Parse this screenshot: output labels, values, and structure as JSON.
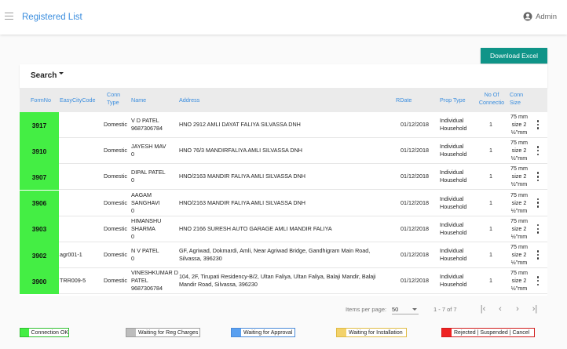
{
  "header": {
    "title": "Registered List",
    "user_name": "Admin"
  },
  "actions": {
    "download_label": "Download Excel",
    "search_label": "Search"
  },
  "table": {
    "columns": {
      "formno": "FormNo",
      "easycitycode": "EasyCityCode",
      "conn_type_1": "Conn",
      "conn_type_2": "Type",
      "name": "Name",
      "address": "Address",
      "rdate": "RDate",
      "prop_type": "Prop Type",
      "no_of_conn_1": "No Of",
      "no_of_conn_2": "Connectio",
      "conn_size_1": "Conn",
      "conn_size_2": "Size"
    },
    "rows": [
      {
        "formno": "3917",
        "code": "",
        "type": "Domestic",
        "name": [
          "V D PATEL",
          "9687306784"
        ],
        "address": [
          "HNO 2912 AMLI DAYAT FALIYA SILVASSA DNH"
        ],
        "rdate": "01/12/2018",
        "prop": [
          "Individual",
          "Household"
        ],
        "conn": "1",
        "size": [
          "75 mm",
          "size 2",
          "½\"mm"
        ]
      },
      {
        "formno": "3910",
        "code": "",
        "type": "Domestic",
        "name": [
          "JAYESH MAV",
          "0"
        ],
        "address": [
          "HNO 76/3 MANDIRFALIYA AMLI SILVASSA DNH"
        ],
        "rdate": "01/12/2018",
        "prop": [
          "Individual",
          "Household"
        ],
        "conn": "1",
        "size": [
          "75 mm",
          "size 2",
          "½\"mm"
        ]
      },
      {
        "formno": "3907",
        "code": "",
        "type": "Domestic",
        "name": [
          "DIPAL PATEL",
          "0"
        ],
        "address": [
          "HNO/2163 MANDIR FALIYA AMLI SILVASSA DNH"
        ],
        "rdate": "01/12/2018",
        "prop": [
          "Individual",
          "Household"
        ],
        "conn": "1",
        "size": [
          "75 mm",
          "size 2",
          "½\"mm"
        ]
      },
      {
        "formno": "3906",
        "code": "",
        "type": "Domestic",
        "name": [
          "AAGAM",
          "SANGHAVI",
          "0"
        ],
        "address": [
          "HNO/2163 MANDIR FALIYA AMLI SILVASSA DNH"
        ],
        "rdate": "01/12/2018",
        "prop": [
          "Individual",
          "Household"
        ],
        "conn": "1",
        "size": [
          "75 mm",
          "size 2",
          "½\"mm"
        ]
      },
      {
        "formno": "3903",
        "code": "",
        "type": "Domestic",
        "name": [
          "HIMANSHU",
          "SHARMA",
          "0"
        ],
        "address": [
          "HNO 2166 SURESH AUTO GARAGE AMLI MANDIR FALIYA"
        ],
        "rdate": "01/12/2018",
        "prop": [
          "Individual",
          "Household"
        ],
        "conn": "1",
        "size": [
          "75 mm",
          "size 2",
          "½\"mm"
        ]
      },
      {
        "formno": "3902",
        "code": "agr001-1",
        "type": "Domestic",
        "name": [
          "N V PATEL",
          "0"
        ],
        "address": [
          "GF, Agriwad, Dokmardi, Amli, Near Agriwad Bridge, Gandhigram Main Road,",
          "Silvassa, 396230"
        ],
        "rdate": "01/12/2018",
        "prop": [
          "Individual",
          "Household"
        ],
        "conn": "1",
        "size": [
          "75 mm",
          "size 2",
          "½\"mm"
        ]
      },
      {
        "formno": "3900",
        "code": "TRR009-5",
        "type": "Domestic",
        "name": [
          "VINESHKUMAR D",
          "PATEL",
          "9687306784"
        ],
        "address": [
          "104, 2F, Tirupati Residency-B/2, Ultan Faliya, Ultan Faliya, Balaji Mandir, Balaji",
          "Mandir Road, Silvassa, 396230"
        ],
        "rdate": "01/12/2018",
        "prop": [
          "Individual",
          "Household"
        ],
        "conn": "1",
        "size": [
          "75 mm",
          "size 2",
          "½\"mm"
        ]
      }
    ]
  },
  "paginator": {
    "items_per_page_label": "Items per page:",
    "page_size": "50",
    "range": "1 - 7 of 7"
  },
  "legend": [
    {
      "label": "Connection OK",
      "color": "#44ee44",
      "border": "#2fbf2f"
    },
    {
      "label": "Waiting for Reg Charges",
      "color": "#bdbdbd",
      "border": "#9e9e9e"
    },
    {
      "label": "Waiting for Approval",
      "color": "#5aa0f0",
      "border": "#4a8ad8"
    },
    {
      "label": "Waiting for Installation",
      "color": "#f3d26a",
      "border": "#e0bb45"
    },
    {
      "label": "Rejected | Suspended | Cancel",
      "color": "#ee2222",
      "border": "#d01c1c"
    }
  ]
}
